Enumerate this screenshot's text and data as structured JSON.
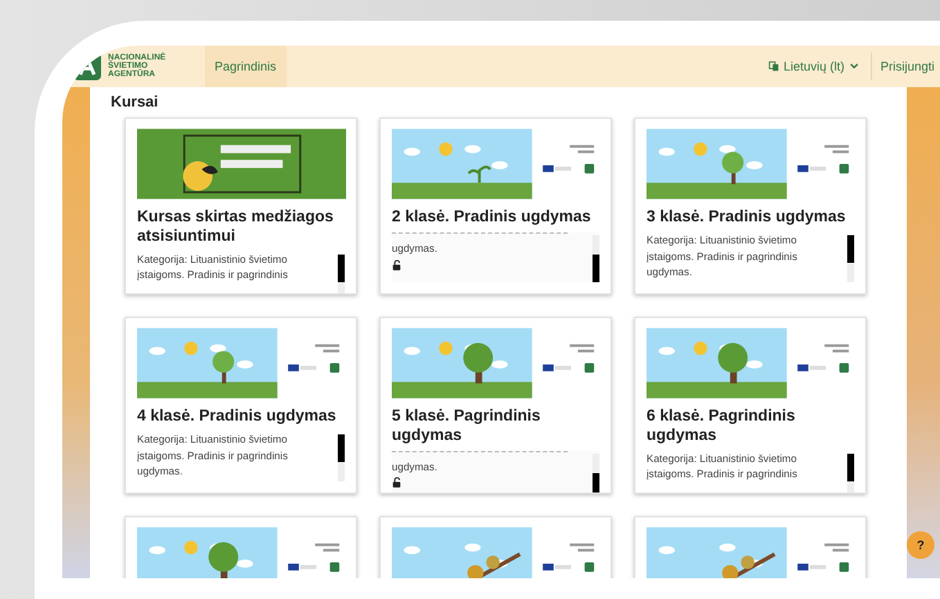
{
  "header": {
    "logo_text": "NACIONALINĖ ŠVIETIMO AGENTŪRA",
    "nav": [
      {
        "label": "Pagrindinis",
        "selected": true
      }
    ],
    "language": "Lietuvių (lt)",
    "login": "Prisijungti"
  },
  "page_title": "Kursai",
  "courses": [
    {
      "kind": "banner",
      "title": "Kursas skirtas medžiagos atsisiuntimui",
      "description": "Kategorija: Lituanistinio švietimo įstaigoms. Pradinis ir pagrindinis",
      "scrolled": false,
      "lock": false
    },
    {
      "kind": "sprout",
      "title": "2 klasė. Pradinis ugdymas",
      "description": "ugdymas.",
      "scrolled": true,
      "lock": true
    },
    {
      "kind": "sapling",
      "title": "3 klasė. Pradinis ugdymas",
      "description": "Kategorija: Lituanistinio švietimo įstaigoms. Pradinis ir pagrindinis ugdymas.",
      "scrolled": false,
      "lock": false
    },
    {
      "kind": "sapling",
      "title": "4 klasė. Pradinis ugdymas",
      "description": "Kategorija: Lituanistinio švietimo įstaigoms. Pradinis ir pagrindinis ugdymas.",
      "scrolled": false,
      "lock": false
    },
    {
      "kind": "tree",
      "title": "5 klasė. Pagrindinis ugdymas",
      "description": "ugdymas.",
      "scrolled": true,
      "lock": true
    },
    {
      "kind": "tree",
      "title": "6 klasė. Pagrindinis ugdymas",
      "description": "Kategorija: Lituanistinio švietimo įstaigoms. Pradinis ir pagrindinis",
      "scrolled": false,
      "lock": false
    },
    {
      "kind": "tree"
    },
    {
      "kind": "branch"
    },
    {
      "kind": "branch"
    }
  ],
  "help": "?"
}
